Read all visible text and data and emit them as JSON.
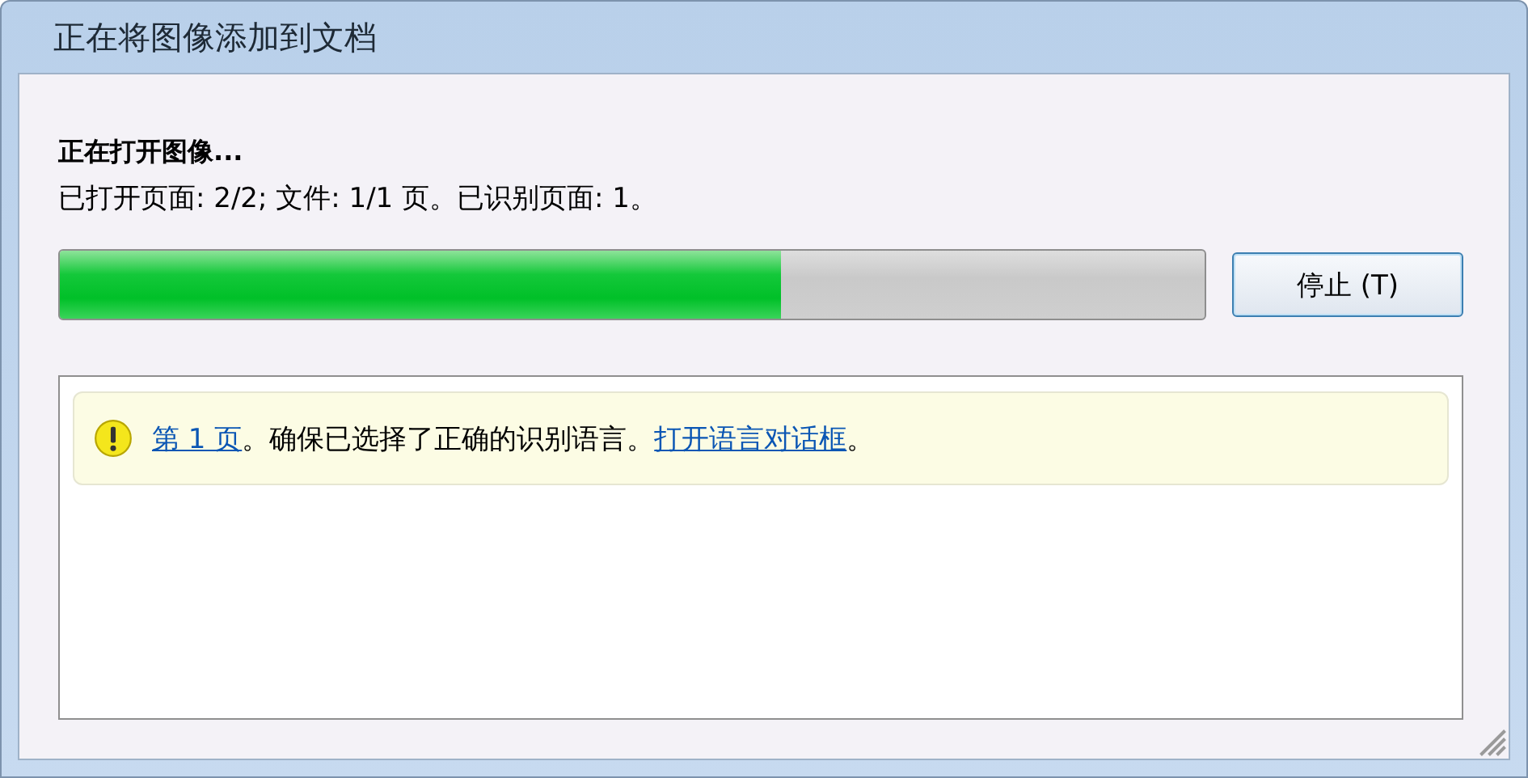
{
  "window": {
    "title": "正在将图像添加到文档"
  },
  "status": {
    "heading": "正在打开图像...",
    "detail": "已打开页面: 2/2; 文件: 1/1 页。已识别页面: 1。"
  },
  "progress": {
    "level": 0.63
  },
  "buttons": [
    {
      "label": "停止 (T)"
    }
  ],
  "messages": [
    {
      "kind": "warning",
      "parts": [
        {
          "kind": "link",
          "text": "第 1 页"
        },
        {
          "kind": "text",
          "text": "。确保已选择了正确的识别语言。"
        },
        {
          "kind": "link",
          "text": "打开语言对话框"
        },
        {
          "kind": "text",
          "text": "。"
        }
      ]
    }
  ]
}
